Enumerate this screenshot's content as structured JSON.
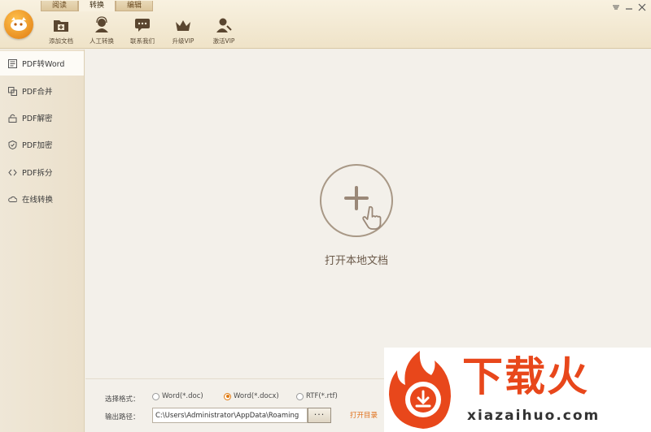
{
  "tabs": [
    {
      "label": "阅读",
      "active": false
    },
    {
      "label": "转换",
      "active": true
    },
    {
      "label": "编辑",
      "active": false
    }
  ],
  "toolbar": [
    {
      "label": "添加文档",
      "icon": "add-folder-icon"
    },
    {
      "label": "人工转换",
      "icon": "service-agent-icon"
    },
    {
      "label": "联系我们",
      "icon": "chat-bubble-icon"
    },
    {
      "label": "升级VIP",
      "icon": "crown-icon"
    },
    {
      "label": "激活VIP",
      "icon": "user-key-icon"
    }
  ],
  "sidebar": {
    "items": [
      {
        "label": "PDF转Word",
        "icon": "word-doc-icon",
        "active": true
      },
      {
        "label": "PDF合并",
        "icon": "merge-icon",
        "active": false
      },
      {
        "label": "PDF解密",
        "icon": "unlock-icon",
        "active": false
      },
      {
        "label": "PDF加密",
        "icon": "shield-icon",
        "active": false
      },
      {
        "label": "PDF拆分",
        "icon": "split-icon",
        "active": false
      },
      {
        "label": "在线转换",
        "icon": "cloud-icon",
        "active": false
      }
    ]
  },
  "main": {
    "open_label": "打开本地文档"
  },
  "options": {
    "format_label": "选择格式：",
    "formats": [
      {
        "label": "Word(*.doc)",
        "selected": false
      },
      {
        "label": "Word(*.docx)",
        "selected": true
      },
      {
        "label": "RTF(*.rtf)",
        "selected": false
      }
    ],
    "path_label": "输出路径：",
    "path_value": "C:\\Users\\Administrator\\AppData\\Roaming",
    "browse_label": "···",
    "open_dir_label": "打开目录"
  },
  "watermark": {
    "title": "下载火",
    "subtitle": "xiazaihuo.com"
  },
  "colors": {
    "accent": "#e07a10",
    "watermark_red": "#e8471b"
  }
}
